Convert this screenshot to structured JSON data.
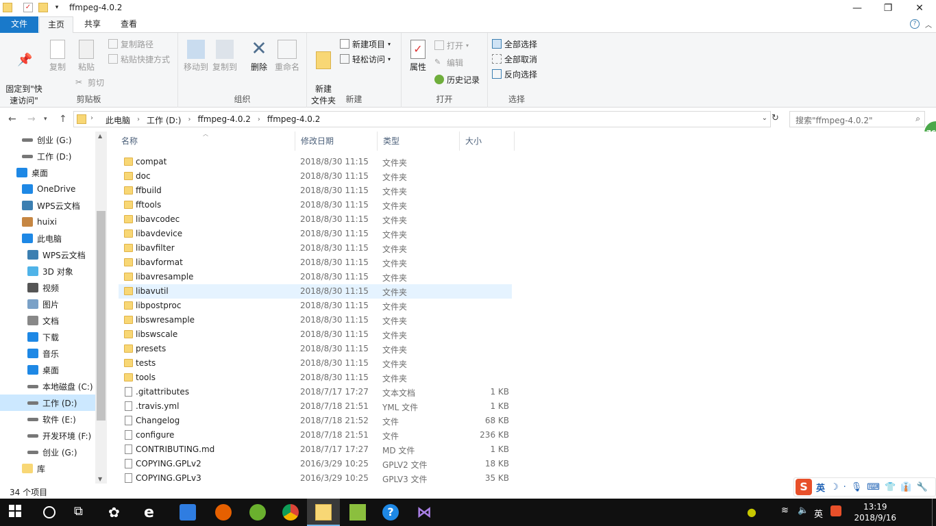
{
  "window": {
    "title": "ffmpeg-4.0.2",
    "minimize": "—",
    "maximize": "❐",
    "close": "✕"
  },
  "ribbon_tabs": [
    "文件",
    "主页",
    "共享",
    "查看"
  ],
  "ribbon": {
    "clipboard": {
      "pin_label": "固定到\"快\n速访问\"",
      "copy_label": "复制",
      "paste_label": "粘贴",
      "copy_path": "复制路径",
      "paste_shortcut": "粘贴快捷方式",
      "cut": "剪切",
      "group": "剪贴板"
    },
    "organize": {
      "move_to": "移动到",
      "copy_to": "复制到",
      "delete": "删除",
      "rename": "重命名",
      "group": "组织"
    },
    "new": {
      "new_folder": "新建\n文件夹",
      "new_item": "新建项目",
      "easy_access": "轻松访问",
      "group": "新建"
    },
    "open": {
      "properties": "属性",
      "open": "打开",
      "edit": "编辑",
      "history": "历史记录",
      "group": "打开"
    },
    "select": {
      "select_all": "全部选择",
      "select_none": "全部取消",
      "invert": "反向选择",
      "group": "选择"
    }
  },
  "address": {
    "crumbs": [
      "此电脑",
      "工作 (D:)",
      "ffmpeg-4.0.2",
      "ffmpeg-4.0.2"
    ],
    "search_placeholder": "搜索\"ffmpeg-4.0.2\""
  },
  "nav_pane": [
    {
      "label": "创业 (G:)",
      "icon": "drive-icon",
      "indent": 1
    },
    {
      "label": "工作 (D:)",
      "icon": "drive-icon",
      "indent": 1
    },
    {
      "label": "桌面",
      "icon": "desktop-icon",
      "indent": 0
    },
    {
      "label": "OneDrive",
      "icon": "onedrive-icon",
      "indent": 1
    },
    {
      "label": "WPS云文档",
      "icon": "cloud-icon",
      "indent": 1
    },
    {
      "label": "huixi",
      "icon": "user-icon",
      "indent": 1
    },
    {
      "label": "此电脑",
      "icon": "computer-icon",
      "indent": 1
    },
    {
      "label": "WPS云文档",
      "icon": "cloud-icon",
      "indent": 2
    },
    {
      "label": "3D 对象",
      "icon": "cube-icon",
      "indent": 2
    },
    {
      "label": "视频",
      "icon": "video-icon",
      "indent": 2
    },
    {
      "label": "图片",
      "icon": "picture-icon",
      "indent": 2
    },
    {
      "label": "文档",
      "icon": "document-icon",
      "indent": 2
    },
    {
      "label": "下载",
      "icon": "download-icon",
      "indent": 2
    },
    {
      "label": "音乐",
      "icon": "music-icon",
      "indent": 2
    },
    {
      "label": "桌面",
      "icon": "desktop-icon",
      "indent": 2
    },
    {
      "label": "本地磁盘 (C:)",
      "icon": "drive-icon",
      "indent": 2
    },
    {
      "label": "工作 (D:)",
      "icon": "drive-icon",
      "indent": 2,
      "selected": true
    },
    {
      "label": "软件 (E:)",
      "icon": "drive-icon",
      "indent": 2
    },
    {
      "label": "开发环境 (F:)",
      "icon": "drive-icon",
      "indent": 2
    },
    {
      "label": "创业 (G:)",
      "icon": "drive-icon",
      "indent": 2
    },
    {
      "label": "库",
      "icon": "library-icon",
      "indent": 1
    }
  ],
  "columns": [
    "名称",
    "修改日期",
    "类型",
    "大小"
  ],
  "files": [
    {
      "name": "compat",
      "date": "2018/8/30 11:15",
      "type": "文件夹",
      "size": "",
      "folder": true
    },
    {
      "name": "doc",
      "date": "2018/8/30 11:15",
      "type": "文件夹",
      "size": "",
      "folder": true
    },
    {
      "name": "ffbuild",
      "date": "2018/8/30 11:15",
      "type": "文件夹",
      "size": "",
      "folder": true
    },
    {
      "name": "fftools",
      "date": "2018/8/30 11:15",
      "type": "文件夹",
      "size": "",
      "folder": true
    },
    {
      "name": "libavcodec",
      "date": "2018/8/30 11:15",
      "type": "文件夹",
      "size": "",
      "folder": true
    },
    {
      "name": "libavdevice",
      "date": "2018/8/30 11:15",
      "type": "文件夹",
      "size": "",
      "folder": true
    },
    {
      "name": "libavfilter",
      "date": "2018/8/30 11:15",
      "type": "文件夹",
      "size": "",
      "folder": true
    },
    {
      "name": "libavformat",
      "date": "2018/8/30 11:15",
      "type": "文件夹",
      "size": "",
      "folder": true
    },
    {
      "name": "libavresample",
      "date": "2018/8/30 11:15",
      "type": "文件夹",
      "size": "",
      "folder": true
    },
    {
      "name": "libavutil",
      "date": "2018/8/30 11:15",
      "type": "文件夹",
      "size": "",
      "folder": true,
      "hover": true
    },
    {
      "name": "libpostproc",
      "date": "2018/8/30 11:15",
      "type": "文件夹",
      "size": "",
      "folder": true
    },
    {
      "name": "libswresample",
      "date": "2018/8/30 11:15",
      "type": "文件夹",
      "size": "",
      "folder": true
    },
    {
      "name": "libswscale",
      "date": "2018/8/30 11:15",
      "type": "文件夹",
      "size": "",
      "folder": true
    },
    {
      "name": "presets",
      "date": "2018/8/30 11:15",
      "type": "文件夹",
      "size": "",
      "folder": true
    },
    {
      "name": "tests",
      "date": "2018/8/30 11:15",
      "type": "文件夹",
      "size": "",
      "folder": true
    },
    {
      "name": "tools",
      "date": "2018/8/30 11:15",
      "type": "文件夹",
      "size": "",
      "folder": true
    },
    {
      "name": ".gitattributes",
      "date": "2018/7/17 17:27",
      "type": "文本文档",
      "size": "1 KB",
      "folder": false
    },
    {
      "name": ".travis.yml",
      "date": "2018/7/18 21:51",
      "type": "YML 文件",
      "size": "1 KB",
      "folder": false
    },
    {
      "name": "Changelog",
      "date": "2018/7/18 21:52",
      "type": "文件",
      "size": "68 KB",
      "folder": false
    },
    {
      "name": "configure",
      "date": "2018/7/18 21:51",
      "type": "文件",
      "size": "236 KB",
      "folder": false
    },
    {
      "name": "CONTRIBUTING.md",
      "date": "2018/7/17 17:27",
      "type": "MD 文件",
      "size": "1 KB",
      "folder": false
    },
    {
      "name": "COPYING.GPLv2",
      "date": "2016/3/29 10:25",
      "type": "GPLV2 文件",
      "size": "18 KB",
      "folder": false
    },
    {
      "name": "COPYING.GPLv3",
      "date": "2016/3/29 10:25",
      "type": "GPLV3 文件",
      "size": "35 KB",
      "folder": false
    }
  ],
  "status": {
    "count": "34 个项目"
  },
  "taskbar": {
    "clock_time": "13:19",
    "clock_date": "2018/9/16",
    "lang": "英",
    "apps": [
      "start-icon",
      "cortana-icon",
      "taskview-icon",
      "app-pinwheel-icon",
      "edge-icon",
      "feishu-icon",
      "firefox-icon",
      "360-browser-icon",
      "chrome-icon",
      "file-explorer-icon",
      "notepad-icon",
      "help-icon",
      "visual-studio-icon"
    ]
  },
  "ime": {
    "lang": "英",
    "logo": "S"
  },
  "side_badge": "76",
  "colors": {
    "accent": "#1979ca",
    "selected": "#cce8ff",
    "hover": "#e5f3ff",
    "folder": "#f8d775",
    "taskbar": "#101010"
  }
}
